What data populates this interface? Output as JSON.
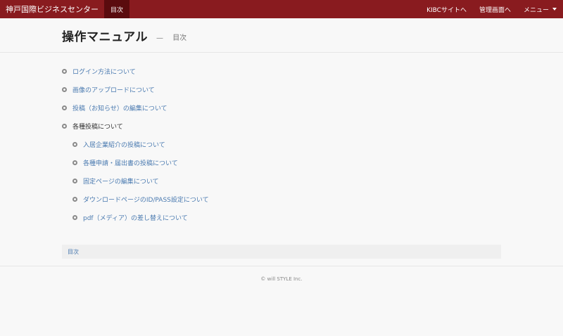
{
  "navbar": {
    "brand": "神戸国際ビジネスセンター",
    "active_item": "目次",
    "right_items": [
      "KIBCサイトへ",
      "管理画面へ"
    ],
    "menu_label": "メニュー"
  },
  "header": {
    "title": "操作マニュアル",
    "separator": "—",
    "subtitle": "目次"
  },
  "toc": {
    "items": [
      "ログイン方法について",
      "画像のアップロードについて",
      "投稿（お知らせ）の編集について",
      "各種投稿について"
    ],
    "subitems": [
      "入居企業紹介の投稿について",
      "各種申請・届出書の投稿について",
      "固定ページの編集について",
      "ダウンロードページのID/PASS設定について",
      "pdf（メディア）の差し替えについて"
    ]
  },
  "breadcrumb": {
    "label": "目次"
  },
  "footer": {
    "copyright": "© will STYLE Inc."
  },
  "colors": {
    "navbar": "#891b1f",
    "navbar_active": "#5a0b0e",
    "link": "#4a7ab0"
  }
}
